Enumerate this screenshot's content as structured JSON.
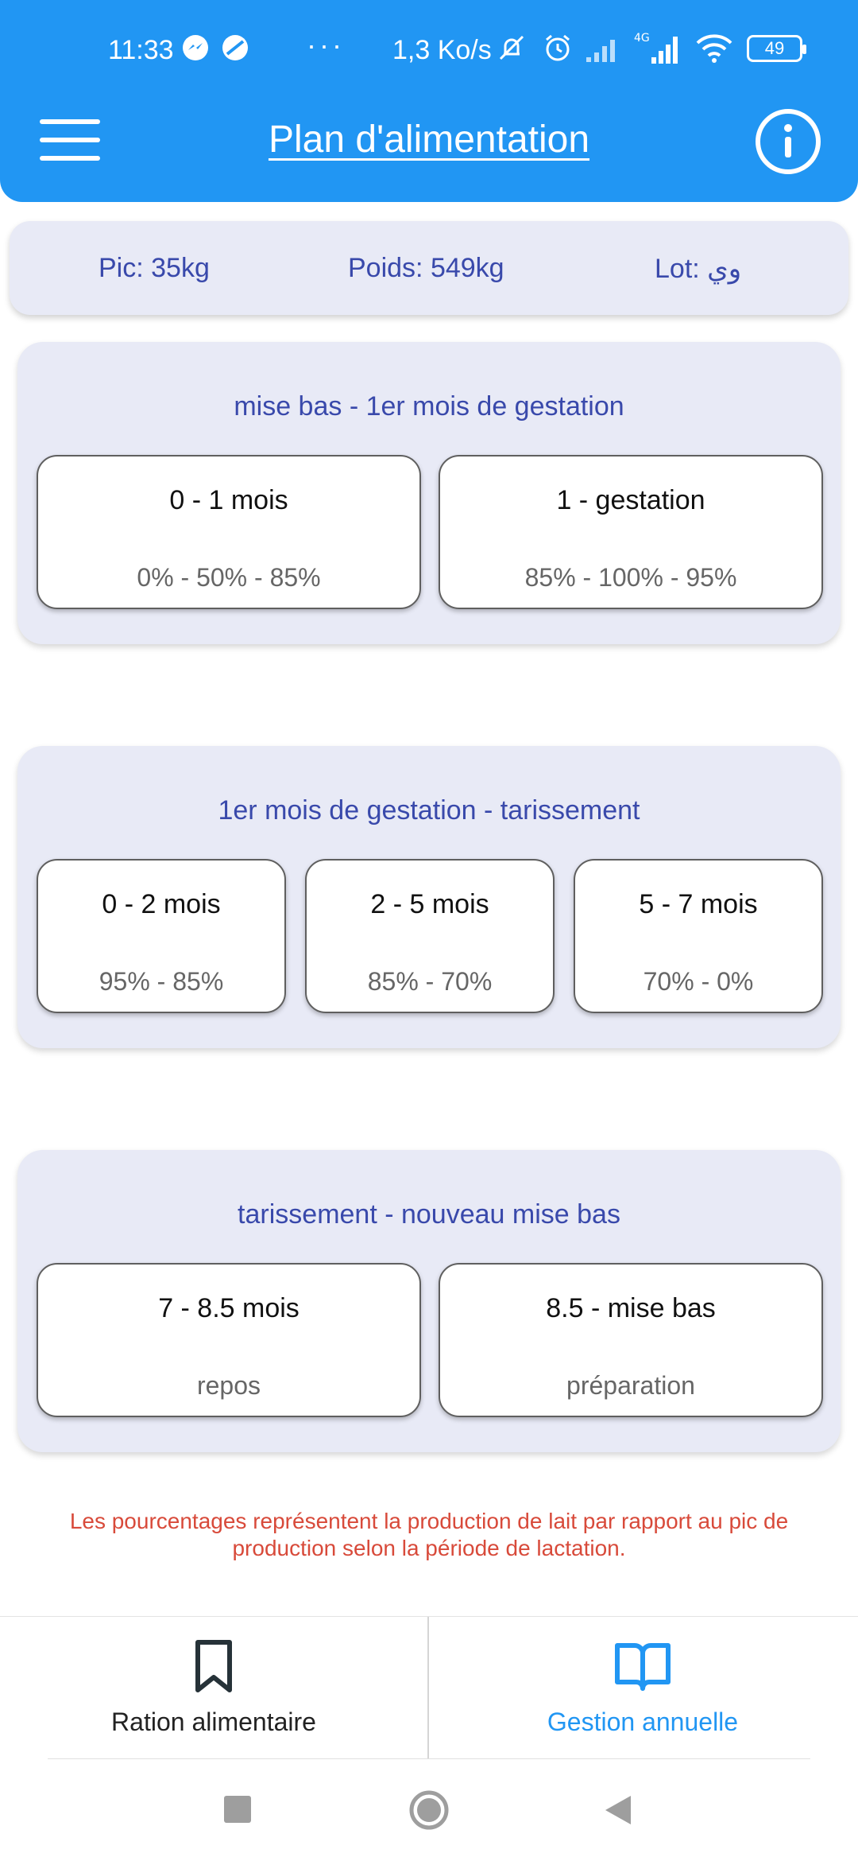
{
  "status_bar": {
    "time": "11:33",
    "speed": "1,3 Ko/s",
    "network": "4G",
    "battery": "49"
  },
  "header": {
    "title": "Plan d'alimentation"
  },
  "summary": {
    "pic": "Pic: 35kg",
    "poids": "Poids: 549kg",
    "lot": "Lot: وي"
  },
  "sections": [
    {
      "title": "mise bas - 1er mois de gestation",
      "tiles": [
        {
          "head": "0 - 1 mois",
          "sub": "0% - 50% - 85%"
        },
        {
          "head": "1 - gestation",
          "sub": "85% - 100% - 95%"
        }
      ]
    },
    {
      "title": "1er mois de gestation - tarissement",
      "tiles": [
        {
          "head": "0 - 2 mois",
          "sub": "95% - 85%"
        },
        {
          "head": "2 - 5 mois",
          "sub": "85% - 70%"
        },
        {
          "head": "5 - 7 mois",
          "sub": "70% - 0%"
        }
      ]
    },
    {
      "title": "tarissement - nouveau mise bas",
      "tiles": [
        {
          "head": "7 - 8.5 mois",
          "sub": "repos"
        },
        {
          "head": "8.5 - mise bas",
          "sub": "préparation"
        }
      ]
    }
  ],
  "note": "Les pourcentages représentent la production de lait par rapport au pic de production selon la période de lactation.",
  "bottom_nav": {
    "left_label": "Ration alimentaire",
    "right_label": "Gestion annuelle"
  },
  "colors": {
    "primary": "#2196f3",
    "card_bg": "#e8eaf6",
    "indigo_text": "#3949ab",
    "note_red": "#d84a3a"
  },
  "icons": {
    "menu": "menu-icon",
    "info": "info-icon",
    "bookmark": "bookmark-icon",
    "book": "book-icon"
  }
}
